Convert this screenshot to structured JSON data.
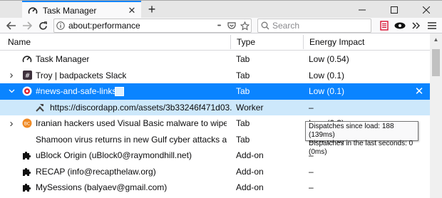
{
  "colors": {
    "accent": "#0a84ff",
    "selected_row": "#0a84ff",
    "selected_child_row": "#cde8fb",
    "reader_icon": "#d70022"
  },
  "browser": {
    "tab_title": "Task Manager",
    "new_tab_label": "+",
    "url": "about:performance",
    "search_placeholder": "Search",
    "page_actions_label": "•••"
  },
  "table": {
    "columns": {
      "name": "Name",
      "type": "Type",
      "energy": "Energy Impact"
    },
    "rows": [
      {
        "name": "Task Manager",
        "type": "Tab",
        "energy": "Low (0.54)",
        "icon": "gauge-icon",
        "twisty": ""
      },
      {
        "name": "Troy | badpackets Slack",
        "type": "Tab",
        "energy": "Low (0.1)",
        "icon": "slack-icon",
        "twisty": "›"
      },
      {
        "name": "#news-and-safe-links-",
        "type": "Tab",
        "energy": "Low (0.1)",
        "icon": "discord-icon",
        "twisty": "˅"
      },
      {
        "name": "https://discordapp.com/assets/3b33246f471d03...",
        "type": "Worker",
        "energy": "–",
        "icon": "worker-icon",
        "twisty": ""
      },
      {
        "name": "Iranian hackers used Visual Basic malware to wipe Ve...",
        "type": "Tab",
        "energy": "Low (0.3)",
        "icon": "bleeping-icon",
        "twisty": "›"
      },
      {
        "name": "Shamoon virus returns in new Gulf cyber attacks after...",
        "type": "Tab",
        "energy": "Low (0.3)",
        "icon": "",
        "twisty": ""
      },
      {
        "name": "uBlock Origin (uBlock0@raymondhill.net)",
        "type": "Add-on",
        "energy": "–",
        "icon": "puzzle-icon",
        "twisty": ""
      },
      {
        "name": "RECAP (info@recapthelaw.org)",
        "type": "Add-on",
        "energy": "–",
        "icon": "puzzle-icon",
        "twisty": ""
      },
      {
        "name": "MySessions (balyaev@gmail.com)",
        "type": "Add-on",
        "energy": "–",
        "icon": "puzzle-icon",
        "twisty": ""
      }
    ]
  },
  "tooltip": {
    "line1": "Dispatches since load: 188 (139ms)",
    "line2": "Dispatches in the last seconds: 0 (0ms)"
  }
}
